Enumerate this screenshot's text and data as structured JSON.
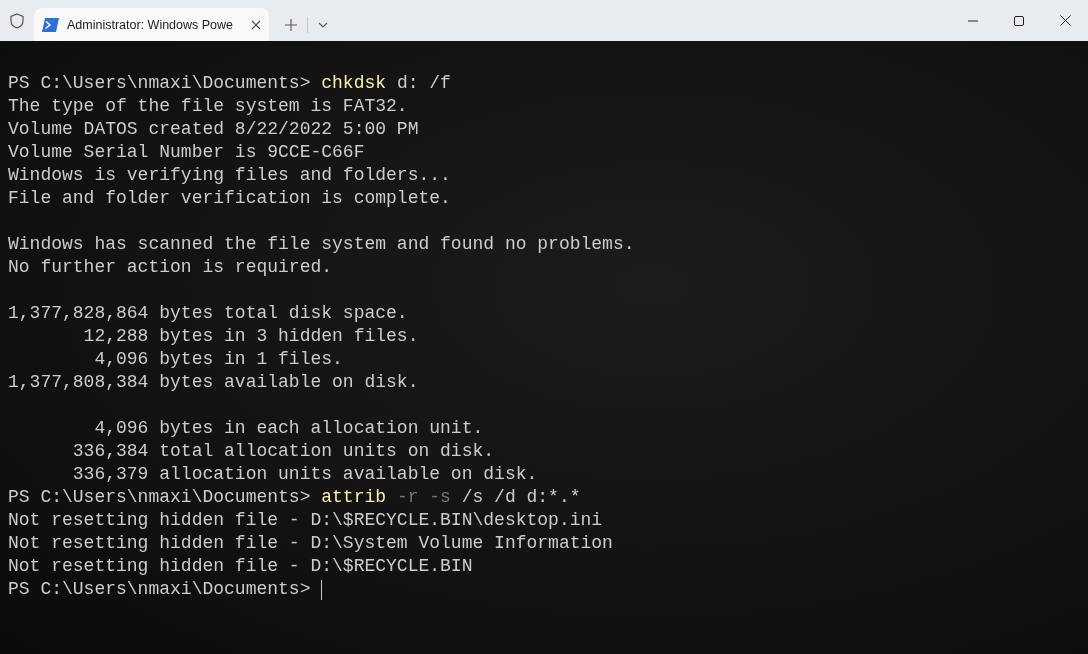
{
  "tab": {
    "title": "Administrator: Windows Powe",
    "selected": true
  },
  "lines": [
    {
      "kind": "blank"
    },
    {
      "kind": "text",
      "segments": [
        {
          "kind": "prompt",
          "text": "PS C:\\Users\\nmaxi\\Documents> "
        },
        {
          "kind": "command",
          "text": "chkdsk"
        },
        {
          "kind": "plain",
          "text": " d: /f"
        }
      ]
    },
    {
      "kind": "text",
      "segments": [
        {
          "kind": "plain",
          "text": "The type of the file system is FAT32."
        }
      ]
    },
    {
      "kind": "text",
      "segments": [
        {
          "kind": "plain",
          "text": "Volume DATOS created 8/22/2022 5:00 PM"
        }
      ]
    },
    {
      "kind": "text",
      "segments": [
        {
          "kind": "plain",
          "text": "Volume Serial Number is 9CCE-C66F"
        }
      ]
    },
    {
      "kind": "text",
      "segments": [
        {
          "kind": "plain",
          "text": "Windows is verifying files and folders..."
        }
      ]
    },
    {
      "kind": "text",
      "segments": [
        {
          "kind": "plain",
          "text": "File and folder verification is complete."
        }
      ]
    },
    {
      "kind": "blank"
    },
    {
      "kind": "text",
      "segments": [
        {
          "kind": "plain",
          "text": "Windows has scanned the file system and found no problems."
        }
      ]
    },
    {
      "kind": "text",
      "segments": [
        {
          "kind": "plain",
          "text": "No further action is required."
        }
      ]
    },
    {
      "kind": "blank"
    },
    {
      "kind": "text",
      "segments": [
        {
          "kind": "plain",
          "text": "1,377,828,864 bytes total disk space."
        }
      ]
    },
    {
      "kind": "text",
      "segments": [
        {
          "kind": "plain",
          "text": "       12,288 bytes in 3 hidden files."
        }
      ]
    },
    {
      "kind": "text",
      "segments": [
        {
          "kind": "plain",
          "text": "        4,096 bytes in 1 files."
        }
      ]
    },
    {
      "kind": "text",
      "segments": [
        {
          "kind": "plain",
          "text": "1,377,808,384 bytes available on disk."
        }
      ]
    },
    {
      "kind": "blank"
    },
    {
      "kind": "text",
      "segments": [
        {
          "kind": "plain",
          "text": "        4,096 bytes in each allocation unit."
        }
      ]
    },
    {
      "kind": "text",
      "segments": [
        {
          "kind": "plain",
          "text": "      336,384 total allocation units on disk."
        }
      ]
    },
    {
      "kind": "text",
      "segments": [
        {
          "kind": "plain",
          "text": "      336,379 allocation units available on disk."
        }
      ]
    },
    {
      "kind": "text",
      "segments": [
        {
          "kind": "prompt",
          "text": "PS C:\\Users\\nmaxi\\Documents> "
        },
        {
          "kind": "command",
          "text": "attrib"
        },
        {
          "kind": "param",
          "text": " -r"
        },
        {
          "kind": "param",
          "text": " -s"
        },
        {
          "kind": "plain",
          "text": " /s /d d:*.*"
        }
      ]
    },
    {
      "kind": "text",
      "segments": [
        {
          "kind": "plain",
          "text": "Not resetting hidden file - D:\\$RECYCLE.BIN\\desktop.ini"
        }
      ]
    },
    {
      "kind": "text",
      "segments": [
        {
          "kind": "plain",
          "text": "Not resetting hidden file - D:\\System Volume Information"
        }
      ]
    },
    {
      "kind": "text",
      "segments": [
        {
          "kind": "plain",
          "text": "Not resetting hidden file - D:\\$RECYCLE.BIN"
        }
      ]
    },
    {
      "kind": "text",
      "cursor": true,
      "segments": [
        {
          "kind": "prompt",
          "text": "PS C:\\Users\\nmaxi\\Documents> "
        }
      ]
    }
  ]
}
